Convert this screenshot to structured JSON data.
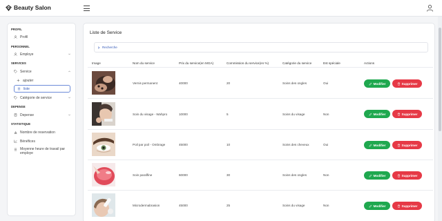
{
  "app": {
    "title": "Beauty Salon"
  },
  "sidebar": {
    "sections": [
      "PROFIL",
      "PERSONNEL",
      "SERVICES",
      "DEPENSE",
      "STATISTIQUE"
    ],
    "items": {
      "profil": "Profil",
      "employe": "Employe",
      "service": "Service",
      "ajouter": "ajouter",
      "liste": "liste",
      "categorie": "Catégorie de service",
      "depense": "Depense",
      "nb_reservation": "Nombre de reservation",
      "benefices": "Bénéfices",
      "moyenne_line1": "Moyenne heure de travail par",
      "moyenne_line2": "employe"
    }
  },
  "main": {
    "title": "Liste de Service",
    "search_label": "Recherche",
    "columns": [
      "Image",
      "Nom du service",
      "Prix du service(en MGA)",
      "Commission du service(en %)",
      "Catégorie du service",
      "Est spéciale",
      "Actions"
    ],
    "edit_label": "Modifier",
    "delete_label": "Supprimer",
    "rows": [
      {
        "nom": "Vernis permanent",
        "prix": "40000",
        "commission": "20",
        "categorie": "Soins des ongles",
        "speciale": "Oui"
      },
      {
        "nom": "Soin du visage - Wahpro",
        "prix": "10000",
        "commission": "5",
        "categorie": "Soins du visage",
        "speciale": "Non"
      },
      {
        "nom": "Poil par poil - Ombrage",
        "prix": "45000",
        "commission": "10",
        "categorie": "Soins des cheveux",
        "speciale": "Oui"
      },
      {
        "nom": "Soin paraffine",
        "prix": "60000",
        "commission": "30",
        "categorie": "Soins des ongles",
        "speciale": "Non"
      },
      {
        "nom": "Microdermabrasion",
        "prix": "45000",
        "commission": "25",
        "categorie": "Soins du visage",
        "speciale": "Non"
      }
    ]
  },
  "colors": {
    "accent": "#3358b8",
    "edit": "#1fa84f",
    "delete": "#e63946"
  }
}
